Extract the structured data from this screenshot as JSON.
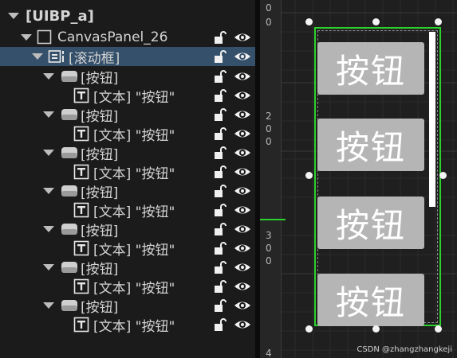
{
  "hierarchy": {
    "root_label": "[UIBP_a]",
    "canvas_panel_label": "CanvasPanel_26",
    "scrollbox_label": "[滚动框]",
    "button_label": "[按钮]",
    "text_label": "[文本] \"按钮\"",
    "button_count": 7
  },
  "canvas": {
    "ruler_numbers": [
      "0",
      "0",
      "2",
      "0",
      "0",
      "3",
      "0",
      "0",
      "4"
    ],
    "button_text": "按钮",
    "visible_buttons": 4
  },
  "watermark": "CSDN @zhangzhangkeji",
  "colors": {
    "selection": "#35506a",
    "selection_outline": "#2dd12d",
    "button_bg": "#b5b5b5"
  }
}
